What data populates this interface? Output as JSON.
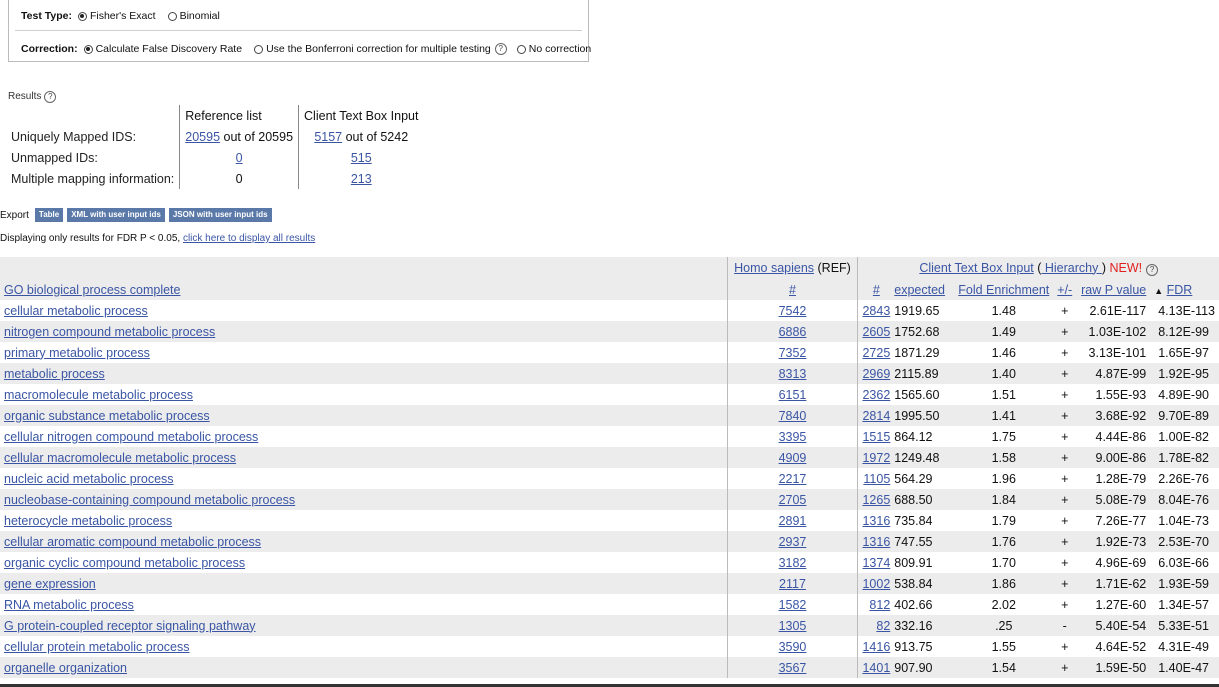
{
  "options": {
    "test_type_label": "Test Type:",
    "test_types": [
      "Fisher's Exact",
      "Binomial"
    ],
    "correction_label": "Correction:",
    "corrections": [
      "Calculate False Discovery Rate",
      "Use the Bonferroni correction for multiple testing",
      "No correction"
    ]
  },
  "results": {
    "label": "Results",
    "ref_header": "Reference list",
    "client_header": "Client Text Box Input",
    "rows": [
      {
        "name": "Uniquely Mapped IDS:",
        "ref_link": "20595",
        "ref_text": " out of 20595",
        "client_link": "5157",
        "client_text": " out of 5242"
      },
      {
        "name": "Unmapped IDs:",
        "ref_link": "0",
        "ref_text": "",
        "client_link": "515",
        "client_text": ""
      },
      {
        "name": "Multiple mapping information:",
        "ref_link": "",
        "ref_text": "0",
        "client_link": "213",
        "client_text": ""
      }
    ]
  },
  "export": {
    "label": "Export",
    "buttons": [
      "Table",
      "XML with user input ids",
      "JSON with user input ids"
    ]
  },
  "display_note": {
    "text": "Displaying only results for FDR P < 0.05, ",
    "link": "click here to display all results"
  },
  "table": {
    "ref_species": "Homo sapiens",
    "ref_suffix": " (REF)",
    "client_link": "Client Text Box Input",
    "hierarchy_prefix": " (",
    "hierarchy_link": " Hierarchy ",
    "hierarchy_suffix": ") ",
    "new_label": "NEW!",
    "go_header": "GO biological process complete",
    "hash": "#",
    "expected": "expected",
    "fold": "Fold Enrichment",
    "plusminus": "+/-",
    "rawp": "raw P value",
    "fdr_arrow": "▲",
    "fdr": "FDR",
    "rows": [
      {
        "term": "cellular metabolic process",
        "ref": "7542",
        "n": "2843",
        "exp": "1919.65",
        "fold": "1.48",
        "pm": "+",
        "raw": "2.61E-117",
        "fdr": "4.13E-113"
      },
      {
        "term": "nitrogen compound metabolic process",
        "ref": "6886",
        "n": "2605",
        "exp": "1752.68",
        "fold": "1.49",
        "pm": "+",
        "raw": "1.03E-102",
        "fdr": "8.12E-99"
      },
      {
        "term": "primary metabolic process",
        "ref": "7352",
        "n": "2725",
        "exp": "1871.29",
        "fold": "1.46",
        "pm": "+",
        "raw": "3.13E-101",
        "fdr": "1.65E-97"
      },
      {
        "term": "metabolic process",
        "ref": "8313",
        "n": "2969",
        "exp": "2115.89",
        "fold": "1.40",
        "pm": "+",
        "raw": "4.87E-99",
        "fdr": "1.92E-95"
      },
      {
        "term": "macromolecule metabolic process",
        "ref": "6151",
        "n": "2362",
        "exp": "1565.60",
        "fold": "1.51",
        "pm": "+",
        "raw": "1.55E-93",
        "fdr": "4.89E-90"
      },
      {
        "term": "organic substance metabolic process",
        "ref": "7840",
        "n": "2814",
        "exp": "1995.50",
        "fold": "1.41",
        "pm": "+",
        "raw": "3.68E-92",
        "fdr": "9.70E-89"
      },
      {
        "term": "cellular nitrogen compound metabolic process",
        "ref": "3395",
        "n": "1515",
        "exp": "864.12",
        "fold": "1.75",
        "pm": "+",
        "raw": "4.44E-86",
        "fdr": "1.00E-82"
      },
      {
        "term": "cellular macromolecule metabolic process",
        "ref": "4909",
        "n": "1972",
        "exp": "1249.48",
        "fold": "1.58",
        "pm": "+",
        "raw": "9.00E-86",
        "fdr": "1.78E-82"
      },
      {
        "term": "nucleic acid metabolic process",
        "ref": "2217",
        "n": "1105",
        "exp": "564.29",
        "fold": "1.96",
        "pm": "+",
        "raw": "1.28E-79",
        "fdr": "2.26E-76"
      },
      {
        "term": "nucleobase-containing compound metabolic process",
        "ref": "2705",
        "n": "1265",
        "exp": "688.50",
        "fold": "1.84",
        "pm": "+",
        "raw": "5.08E-79",
        "fdr": "8.04E-76"
      },
      {
        "term": "heterocycle metabolic process",
        "ref": "2891",
        "n": "1316",
        "exp": "735.84",
        "fold": "1.79",
        "pm": "+",
        "raw": "7.26E-77",
        "fdr": "1.04E-73"
      },
      {
        "term": "cellular aromatic compound metabolic process",
        "ref": "2937",
        "n": "1316",
        "exp": "747.55",
        "fold": "1.76",
        "pm": "+",
        "raw": "1.92E-73",
        "fdr": "2.53E-70"
      },
      {
        "term": "organic cyclic compound metabolic process",
        "ref": "3182",
        "n": "1374",
        "exp": "809.91",
        "fold": "1.70",
        "pm": "+",
        "raw": "4.96E-69",
        "fdr": "6.03E-66"
      },
      {
        "term": "gene expression",
        "ref": "2117",
        "n": "1002",
        "exp": "538.84",
        "fold": "1.86",
        "pm": "+",
        "raw": "1.71E-62",
        "fdr": "1.93E-59"
      },
      {
        "term": "RNA metabolic process",
        "ref": "1582",
        "n": "812",
        "exp": "402.66",
        "fold": "2.02",
        "pm": "+",
        "raw": "1.27E-60",
        "fdr": "1.34E-57"
      },
      {
        "term": "G protein-coupled receptor signaling pathway",
        "ref": "1305",
        "n": "82",
        "exp": "332.16",
        "fold": ".25",
        "pm": "-",
        "raw": "5.40E-54",
        "fdr": "5.33E-51"
      },
      {
        "term": "cellular protein metabolic process",
        "ref": "3590",
        "n": "1416",
        "exp": "913.75",
        "fold": "1.55",
        "pm": "+",
        "raw": "4.64E-52",
        "fdr": "4.31E-49"
      },
      {
        "term": "organelle organization",
        "ref": "3567",
        "n": "1401",
        "exp": "907.90",
        "fold": "1.54",
        "pm": "+",
        "raw": "1.59E-50",
        "fdr": "1.40E-47"
      }
    ]
  }
}
